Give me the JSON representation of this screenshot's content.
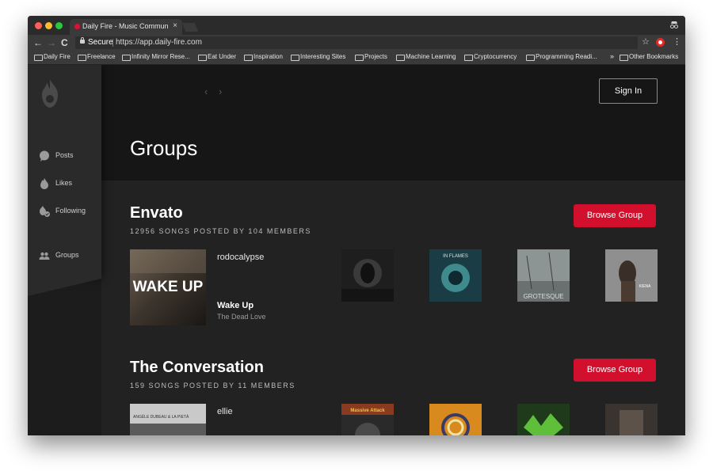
{
  "browser": {
    "tab_title": "Daily Fire - Music Communities",
    "tab_close": "×",
    "back": "←",
    "forward": "→",
    "reload": "C",
    "secure_label": "Secure",
    "url": "https://app.daily-fire.com",
    "star": "☆",
    "menu": "⋮",
    "bookmarks": [
      {
        "label": "Daily Fire"
      },
      {
        "label": "Freelance"
      },
      {
        "label": "Infinity Mirror Rese..."
      },
      {
        "label": "Eat Under"
      },
      {
        "label": "Inspiration"
      },
      {
        "label": "Interesting Sites"
      },
      {
        "label": "Projects"
      },
      {
        "label": "Machine Learning"
      },
      {
        "label": "Cryptocurrency"
      },
      {
        "label": "Programming Readi..."
      }
    ],
    "bookmarks_more": "»",
    "other_bookmarks": "Other Bookmarks"
  },
  "header": {
    "back_arrow": "‹",
    "forward_arrow": "›",
    "sign_in": "Sign In",
    "page_title": "Groups"
  },
  "sidebar": {
    "items": [
      {
        "label": "Posts",
        "icon": "chat-bubble-icon"
      },
      {
        "label": "Likes",
        "icon": "flame-icon"
      },
      {
        "label": "Following",
        "icon": "follow-check-icon"
      },
      {
        "label": "Groups",
        "icon": "people-icon"
      }
    ]
  },
  "groups": [
    {
      "name": "Envato",
      "meta": "12956 SONGS POSTED BY 104 MEMBERS",
      "browse_label": "Browse Group",
      "featured": {
        "user": "rodocalypse",
        "song": "Wake Up",
        "artist": "The Dead Love",
        "cover_text": "WAKE UP"
      },
      "thumb_texts": [
        "",
        "IN FLAMES",
        "GROTESQUE",
        "KIENA"
      ]
    },
    {
      "name": "The Conversation",
      "meta": "159 SONGS POSTED BY 11 MEMBERS",
      "browse_label": "Browse Group",
      "featured": {
        "user": "ellie",
        "cover_text": "ANGÈLE DUBEAU & LA PIETÀ"
      },
      "thumb_texts": [
        "Massive Attack",
        "",
        "",
        ""
      ]
    }
  ],
  "colors": {
    "accent": "#d2102e",
    "background": "#1c1c1c",
    "sidebar": "#2a2a2a"
  }
}
